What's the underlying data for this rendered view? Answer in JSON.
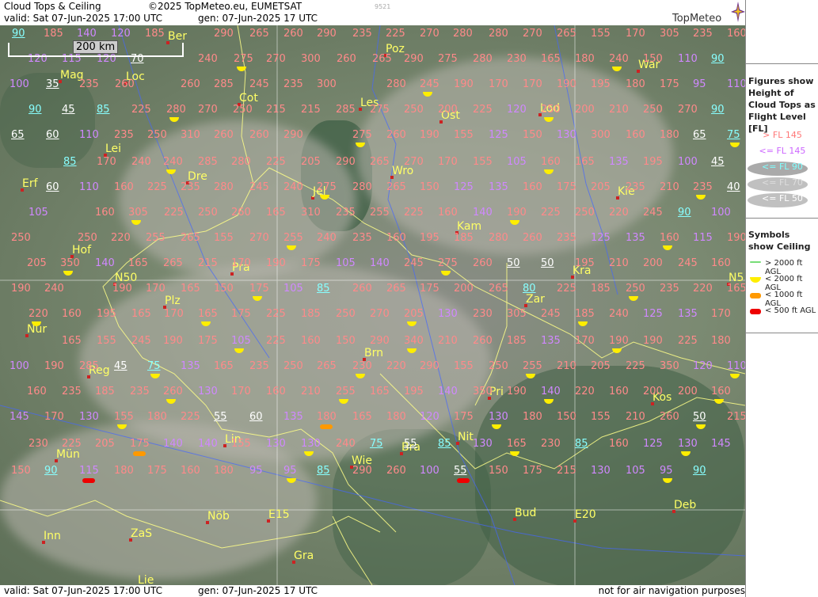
{
  "header": {
    "title": "Cloud Tops & Ceiling",
    "copyright": "©2025 TopMeteo.eu, EUMETSAT",
    "valid": "valid:  Sat  07-Jun-2025  17:00 UTC",
    "gen": "gen: 07-Jun-2025 17 UTC",
    "image_number": "9521",
    "logo": "TopMeteo"
  },
  "footer": {
    "valid": "valid:  Sat  07-Jun-2025  17:00 UTC",
    "gen": "gen: 07-Jun-2025 17 UTC",
    "notice": "not for air navigation purposes"
  },
  "scale_label": "200 km",
  "legend": {
    "heading_fig": "Figures show Height of Cloud Tops as Flight Level  [FL]",
    "fl_items": [
      "> FL 145",
      "<= FL 145",
      "<= FL 90",
      "<= FL 70",
      "<= FL 50"
    ],
    "fl_colors": [
      "#ff8080",
      "#d080ff",
      "#80ffff",
      "#dddddd",
      "#ffffff"
    ],
    "heading_sym": "Symbols show Ceiling",
    "sym_items": [
      "> 2000 ft AGL",
      "< 2000 ft AGL",
      "< 1000 ft AGL",
      "< 500 ft AGL"
    ],
    "sym_colors": [
      "#77dd77",
      "#ffee00",
      "#ff9900",
      "#ee0000"
    ]
  },
  "cities": [
    "Ber",
    "Poz",
    "War",
    "Mag",
    "Loc",
    "Cot",
    "Les",
    "Lod",
    "Ost",
    "Lei",
    "Dre",
    "Wro",
    "Jel",
    "Erf",
    "Kie",
    "Kam",
    "Hof",
    "Pra",
    "Kra",
    "N50",
    "N5",
    "Plz",
    "Zar",
    "Nür",
    "Reg",
    "Brn",
    "Kos",
    "Pri",
    "Lin",
    "Mün",
    "Wie",
    "Bra",
    "Nit",
    "E15",
    "Nöb",
    "Inn",
    "ZaS",
    "Bud",
    "E20",
    "Deb",
    "Gra",
    "Lie"
  ],
  "values": [
    "90",
    "185",
    "140",
    "120",
    "185",
    "290",
    "265",
    "260",
    "290",
    "235",
    "225",
    "270",
    "280",
    "280",
    "270",
    "265",
    "155",
    "170",
    "305",
    "235",
    "160",
    "120",
    "115",
    "120",
    "70",
    "240",
    "275",
    "270",
    "300",
    "260",
    "265",
    "290",
    "275",
    "280",
    "230",
    "165",
    "180",
    "240",
    "150",
    "110",
    "90",
    "100",
    "35",
    "235",
    "260",
    "260",
    "285",
    "245",
    "235",
    "300",
    "280",
    "245",
    "190",
    "170",
    "170",
    "190",
    "195",
    "180",
    "175",
    "95",
    "110",
    "90",
    "45",
    "85",
    "225",
    "280",
    "270",
    "250",
    "215",
    "215",
    "285",
    "275",
    "250",
    "200",
    "225",
    "120",
    "250",
    "200",
    "210",
    "250",
    "270",
    "90",
    "65",
    "60",
    "110",
    "235",
    "250",
    "310",
    "260",
    "260",
    "290",
    "275",
    "260",
    "190",
    "155",
    "125",
    "150",
    "130",
    "300",
    "160",
    "180",
    "65",
    "75",
    "85",
    "170",
    "240",
    "240",
    "285",
    "280",
    "225",
    "205",
    "290",
    "265",
    "270",
    "170",
    "155",
    "105",
    "160",
    "165",
    "135",
    "195",
    "100",
    "45",
    "60",
    "110",
    "160",
    "225",
    "235",
    "280",
    "245",
    "240",
    "275",
    "280",
    "265",
    "150",
    "125",
    "135",
    "160",
    "175",
    "205",
    "235",
    "210",
    "235",
    "40",
    "105",
    "160",
    "305",
    "225",
    "250",
    "260",
    "165",
    "310",
    "235",
    "255",
    "225",
    "160",
    "140",
    "190",
    "225",
    "250",
    "220",
    "245",
    "90",
    "100",
    "250",
    "250",
    "220",
    "255",
    "265",
    "155",
    "270",
    "255",
    "240",
    "235",
    "160",
    "195",
    "185",
    "280",
    "260",
    "235",
    "125",
    "135",
    "160",
    "115",
    "190",
    "205",
    "350",
    "140",
    "165",
    "265",
    "215",
    "170",
    "190",
    "175",
    "105",
    "140",
    "245",
    "275",
    "260",
    "50",
    "50",
    "195",
    "210",
    "200",
    "245",
    "160",
    "190",
    "240",
    "190",
    "170",
    "165",
    "150",
    "175",
    "105",
    "85",
    "260",
    "265",
    "175",
    "200",
    "265",
    "80",
    "225",
    "185",
    "250",
    "235",
    "220",
    "165",
    "220",
    "160",
    "195",
    "165",
    "170",
    "165",
    "175",
    "225",
    "185",
    "250",
    "270",
    "205",
    "130",
    "230",
    "305",
    "245",
    "185",
    "240",
    "125",
    "135",
    "170",
    "165",
    "155",
    "245",
    "190",
    "175",
    "105",
    "225",
    "160",
    "150",
    "290",
    "340",
    "210",
    "260",
    "185",
    "135",
    "170",
    "190",
    "190",
    "225",
    "180",
    "100",
    "190",
    "285",
    "45",
    "75",
    "135",
    "165",
    "235",
    "250",
    "265",
    "230",
    "220",
    "290",
    "155",
    "250",
    "255",
    "210",
    "205",
    "225",
    "350",
    "120",
    "110",
    "160",
    "235",
    "185",
    "235",
    "260",
    "130",
    "170",
    "160",
    "210",
    "255",
    "165",
    "195",
    "140",
    "350",
    "190",
    "140",
    "220",
    "160",
    "200",
    "200",
    "160",
    "145",
    "170",
    "130",
    "155",
    "180",
    "225",
    "55",
    "60",
    "135",
    "180",
    "165",
    "180",
    "120",
    "175",
    "130",
    "180",
    "150",
    "155",
    "210",
    "260",
    "50",
    "215",
    "230",
    "225",
    "205",
    "175",
    "140",
    "140",
    "155",
    "130",
    "130",
    "240",
    "75",
    "55",
    "85",
    "130",
    "165",
    "230",
    "85",
    "160",
    "125",
    "130",
    "145",
    "150",
    "90",
    "115",
    "180",
    "175",
    "160",
    "180",
    "95",
    "95",
    "85",
    "290",
    "260",
    "100",
    "55",
    "150",
    "175",
    "215",
    "130",
    "105",
    "95",
    "90"
  ]
}
